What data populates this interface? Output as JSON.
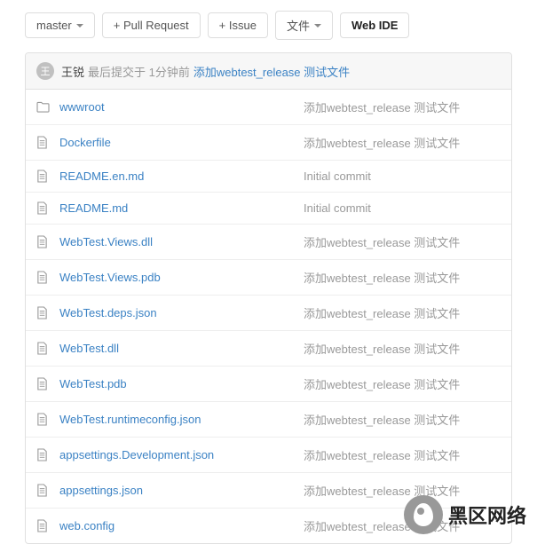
{
  "toolbar": {
    "branch_label": "master",
    "pull_request_label": "+ Pull Request",
    "issue_label": "+ Issue",
    "files_label": "文件",
    "webide_label": "Web IDE"
  },
  "commit": {
    "avatar_initial": "王",
    "author": "王锐",
    "meta": "最后提交于 1分钟前",
    "message": "添加webtest_release 测试文件"
  },
  "files": [
    {
      "type": "folder",
      "name": "wwwroot",
      "msg": "添加webtest_release 测试文件"
    },
    {
      "type": "file",
      "name": "Dockerfile",
      "msg": "添加webtest_release 测试文件"
    },
    {
      "type": "file",
      "name": "README.en.md",
      "msg": "Initial commit"
    },
    {
      "type": "file",
      "name": "README.md",
      "msg": "Initial commit"
    },
    {
      "type": "file",
      "name": "WebTest.Views.dll",
      "msg": "添加webtest_release 测试文件"
    },
    {
      "type": "file",
      "name": "WebTest.Views.pdb",
      "msg": "添加webtest_release 测试文件"
    },
    {
      "type": "file",
      "name": "WebTest.deps.json",
      "msg": "添加webtest_release 测试文件"
    },
    {
      "type": "file",
      "name": "WebTest.dll",
      "msg": "添加webtest_release 测试文件"
    },
    {
      "type": "file",
      "name": "WebTest.pdb",
      "msg": "添加webtest_release 测试文件"
    },
    {
      "type": "file",
      "name": "WebTest.runtimeconfig.json",
      "msg": "添加webtest_release 测试文件"
    },
    {
      "type": "file",
      "name": "appsettings.Development.json",
      "msg": "添加webtest_release 测试文件"
    },
    {
      "type": "file",
      "name": "appsettings.json",
      "msg": "添加webtest_release 测试文件"
    },
    {
      "type": "file",
      "name": "web.config",
      "msg": "添加webtest_release 测试文件"
    }
  ],
  "watermark": {
    "text": "黑区网络"
  }
}
